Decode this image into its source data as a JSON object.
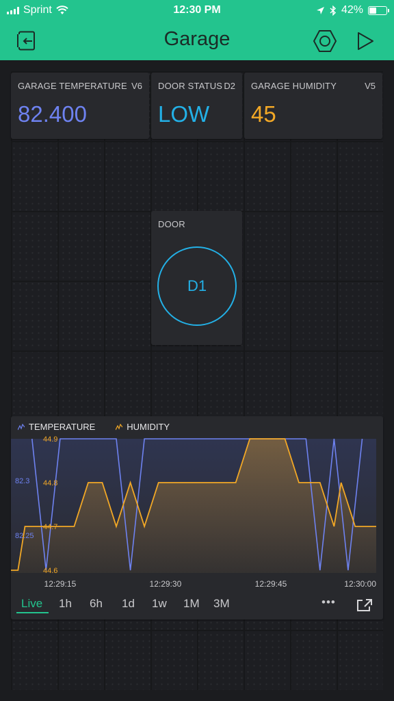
{
  "status_bar": {
    "carrier": "Sprint",
    "time": "12:30 PM",
    "battery": "42%",
    "battery_level": 0.42
  },
  "nav": {
    "title": "Garage",
    "icons": {
      "back": "exit-project-icon",
      "settings": "hexagon-settings-icon",
      "play": "play-icon"
    }
  },
  "widgets": {
    "temperature": {
      "label": "GARAGE TEMPERATURE",
      "pin": "V6",
      "value": "82.400",
      "color": "#6e82f0"
    },
    "door_status": {
      "label": "DOOR STATUS",
      "pin": "D2",
      "value": "LOW",
      "color": "#23b0e6"
    },
    "humidity": {
      "label": "GARAGE HUMIDITY",
      "pin": "V5",
      "value": "45",
      "color": "#f2a826"
    },
    "door": {
      "label": "DOOR",
      "button": "D1",
      "color": "#23b0e6"
    }
  },
  "chart_data": {
    "type": "line",
    "series": [
      {
        "name": "TEMPERATURE",
        "color": "#6e82f0",
        "x": [
          0,
          2,
          3,
          4,
          5,
          7,
          8,
          9,
          10,
          13,
          14,
          15,
          16
        ],
        "values": [
          82.3,
          82.3,
          82.3,
          82.2,
          82.4,
          82.4,
          82.3,
          82.2,
          82.4,
          82.4,
          82.2,
          82.4,
          82.4
        ]
      },
      {
        "name": "HUMIDITY",
        "color": "#f2a826",
        "x": [
          0,
          1,
          2,
          3,
          4,
          5,
          6,
          7,
          8,
          9,
          10,
          11,
          12,
          13,
          14,
          15,
          16
        ],
        "values": [
          44.6,
          44.6,
          44.7,
          44.7,
          44.8,
          44.8,
          44.7,
          44.8,
          44.7,
          44.8,
          44.8,
          44.8,
          44.8,
          44.8,
          44.8,
          44.9,
          44.9
        ]
      }
    ],
    "humidity_points": [
      [
        "12:29:08",
        44.6
      ],
      [
        "12:29:09",
        44.6
      ],
      [
        "12:29:10",
        44.7
      ],
      [
        "12:29:17",
        44.7
      ],
      [
        "12:29:19",
        44.8
      ],
      [
        "12:29:21",
        44.8
      ],
      [
        "12:29:23",
        44.7
      ],
      [
        "12:29:25",
        44.8
      ],
      [
        "12:29:27",
        44.7
      ],
      [
        "12:29:29",
        44.8
      ],
      [
        "12:29:40",
        44.8
      ],
      [
        "12:29:42",
        44.9
      ],
      [
        "12:29:47",
        44.9
      ],
      [
        "12:29:49",
        44.8
      ],
      [
        "12:29:52",
        44.8
      ],
      [
        "12:29:54",
        44.7
      ],
      [
        "12:29:55",
        44.8
      ],
      [
        "12:29:57",
        44.7
      ],
      [
        "12:30:00",
        44.7
      ]
    ],
    "temperature_points": [
      [
        "12:29:11",
        82.36
      ],
      [
        "12:29:13",
        82.2
      ],
      [
        "12:29:15",
        82.36
      ],
      [
        "12:29:23",
        82.36
      ],
      [
        "12:29:25",
        82.2
      ],
      [
        "12:29:27",
        82.36
      ],
      [
        "12:29:50",
        82.36
      ],
      [
        "12:29:52",
        82.2
      ],
      [
        "12:29:54",
        82.36
      ],
      [
        "12:29:56",
        82.2
      ],
      [
        "12:29:58",
        82.36
      ]
    ],
    "humidity_ticks": [
      "44.9",
      "44.8",
      "44.7",
      "44.6"
    ],
    "humidity_tick_values": [
      44.9,
      44.8,
      44.7,
      44.6
    ],
    "temperature_ticks": [
      "82.3",
      "82.25"
    ],
    "temperature_tick_values": [
      82.3,
      82.25
    ],
    "humidity_range": [
      44.6,
      44.9
    ],
    "temperature_range": [
      82.2,
      82.36
    ],
    "x_range": [
      "12:29:08",
      "12:30:00"
    ],
    "x_ticks": [
      "12:29:15",
      "12:29:30",
      "12:29:45",
      "12:30:00"
    ]
  },
  "chart_controls": {
    "periods": [
      "Live",
      "1h",
      "6h",
      "1d",
      "1w",
      "1M",
      "3M"
    ],
    "active_period": "Live",
    "more": "•••",
    "icons": {
      "more": "more-dots-icon",
      "expand": "expand-icon"
    }
  }
}
